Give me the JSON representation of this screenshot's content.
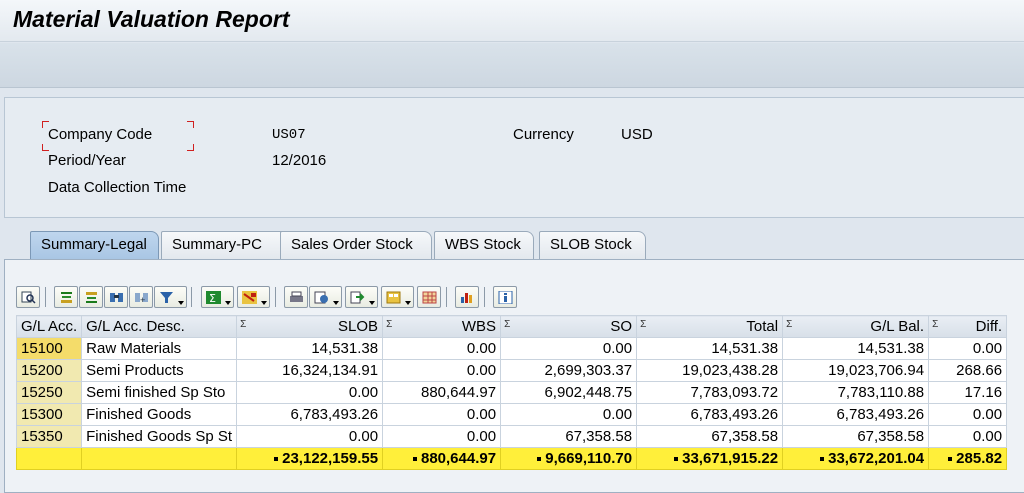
{
  "window": {
    "title": "Material Valuation Report"
  },
  "header": {
    "company_code_label": "Company Code",
    "company_code_value": "US07",
    "currency_label": "Currency",
    "currency_value": "USD",
    "period_label": "Period/Year",
    "period_value": "12/2016",
    "data_collection_label": "Data Collection Time"
  },
  "tabs": [
    {
      "label": "Summary-Legal",
      "active": true
    },
    {
      "label": "Summary-PC"
    },
    {
      "label": "Sales Order Stock"
    },
    {
      "label": "WBS Stock"
    },
    {
      "label": "SLOB Stock"
    }
  ],
  "toolbar": {
    "icons": [
      "details-icon",
      "sort-ascending-icon",
      "sort-descending-icon",
      "find-icon",
      "find-next-icon",
      "filter-icon",
      "sum-icon",
      "subtotal-icon",
      "print-icon",
      "layout-icon",
      "export-icon",
      "layout-select-icon",
      "grid-icon",
      "chart-icon",
      "info-icon"
    ]
  },
  "table": {
    "columns": [
      "G/L Acc.",
      "G/L Acc. Desc.",
      "SLOB",
      "WBS",
      "SO",
      "Total",
      "G/L Bal.",
      "Diff."
    ],
    "sum_mark": "Σ",
    "rows": [
      {
        "acc": "15100",
        "desc": "Raw Materials",
        "slob": "14,531.38",
        "wbs": "0.00",
        "so": "0.00",
        "total": "14,531.38",
        "gl": "14,531.38",
        "diff": "0.00"
      },
      {
        "acc": "15200",
        "desc": "Semi Products",
        "slob": "16,324,134.91",
        "wbs": "0.00",
        "so": "2,699,303.37",
        "total": "19,023,438.28",
        "gl": "19,023,706.94",
        "diff": "268.66"
      },
      {
        "acc": "15250",
        "desc": "Semi finished Sp Sto",
        "slob": "0.00",
        "wbs": "880,644.97",
        "so": "6,902,448.75",
        "total": "7,783,093.72",
        "gl": "7,783,110.88",
        "diff": "17.16"
      },
      {
        "acc": "15300",
        "desc": "Finished Goods",
        "slob": "6,783,493.26",
        "wbs": "0.00",
        "so": "0.00",
        "total": "6,783,493.26",
        "gl": "6,783,493.26",
        "diff": "0.00"
      },
      {
        "acc": "15350",
        "desc": "Finished Goods Sp St",
        "slob": "0.00",
        "wbs": "0.00",
        "so": "67,358.58",
        "total": "67,358.58",
        "gl": "67,358.58",
        "diff": "0.00"
      }
    ],
    "totals": {
      "slob": "23,122,159.55",
      "wbs": "880,644.97",
      "so": "9,669,110.70",
      "total": "33,671,915.22",
      "gl": "33,672,201.04",
      "diff": "285.82"
    }
  },
  "colors": {
    "total_row": "#ffef3a",
    "key_cell": "#f1e9b0",
    "active_tab": "#a9c6e4"
  }
}
